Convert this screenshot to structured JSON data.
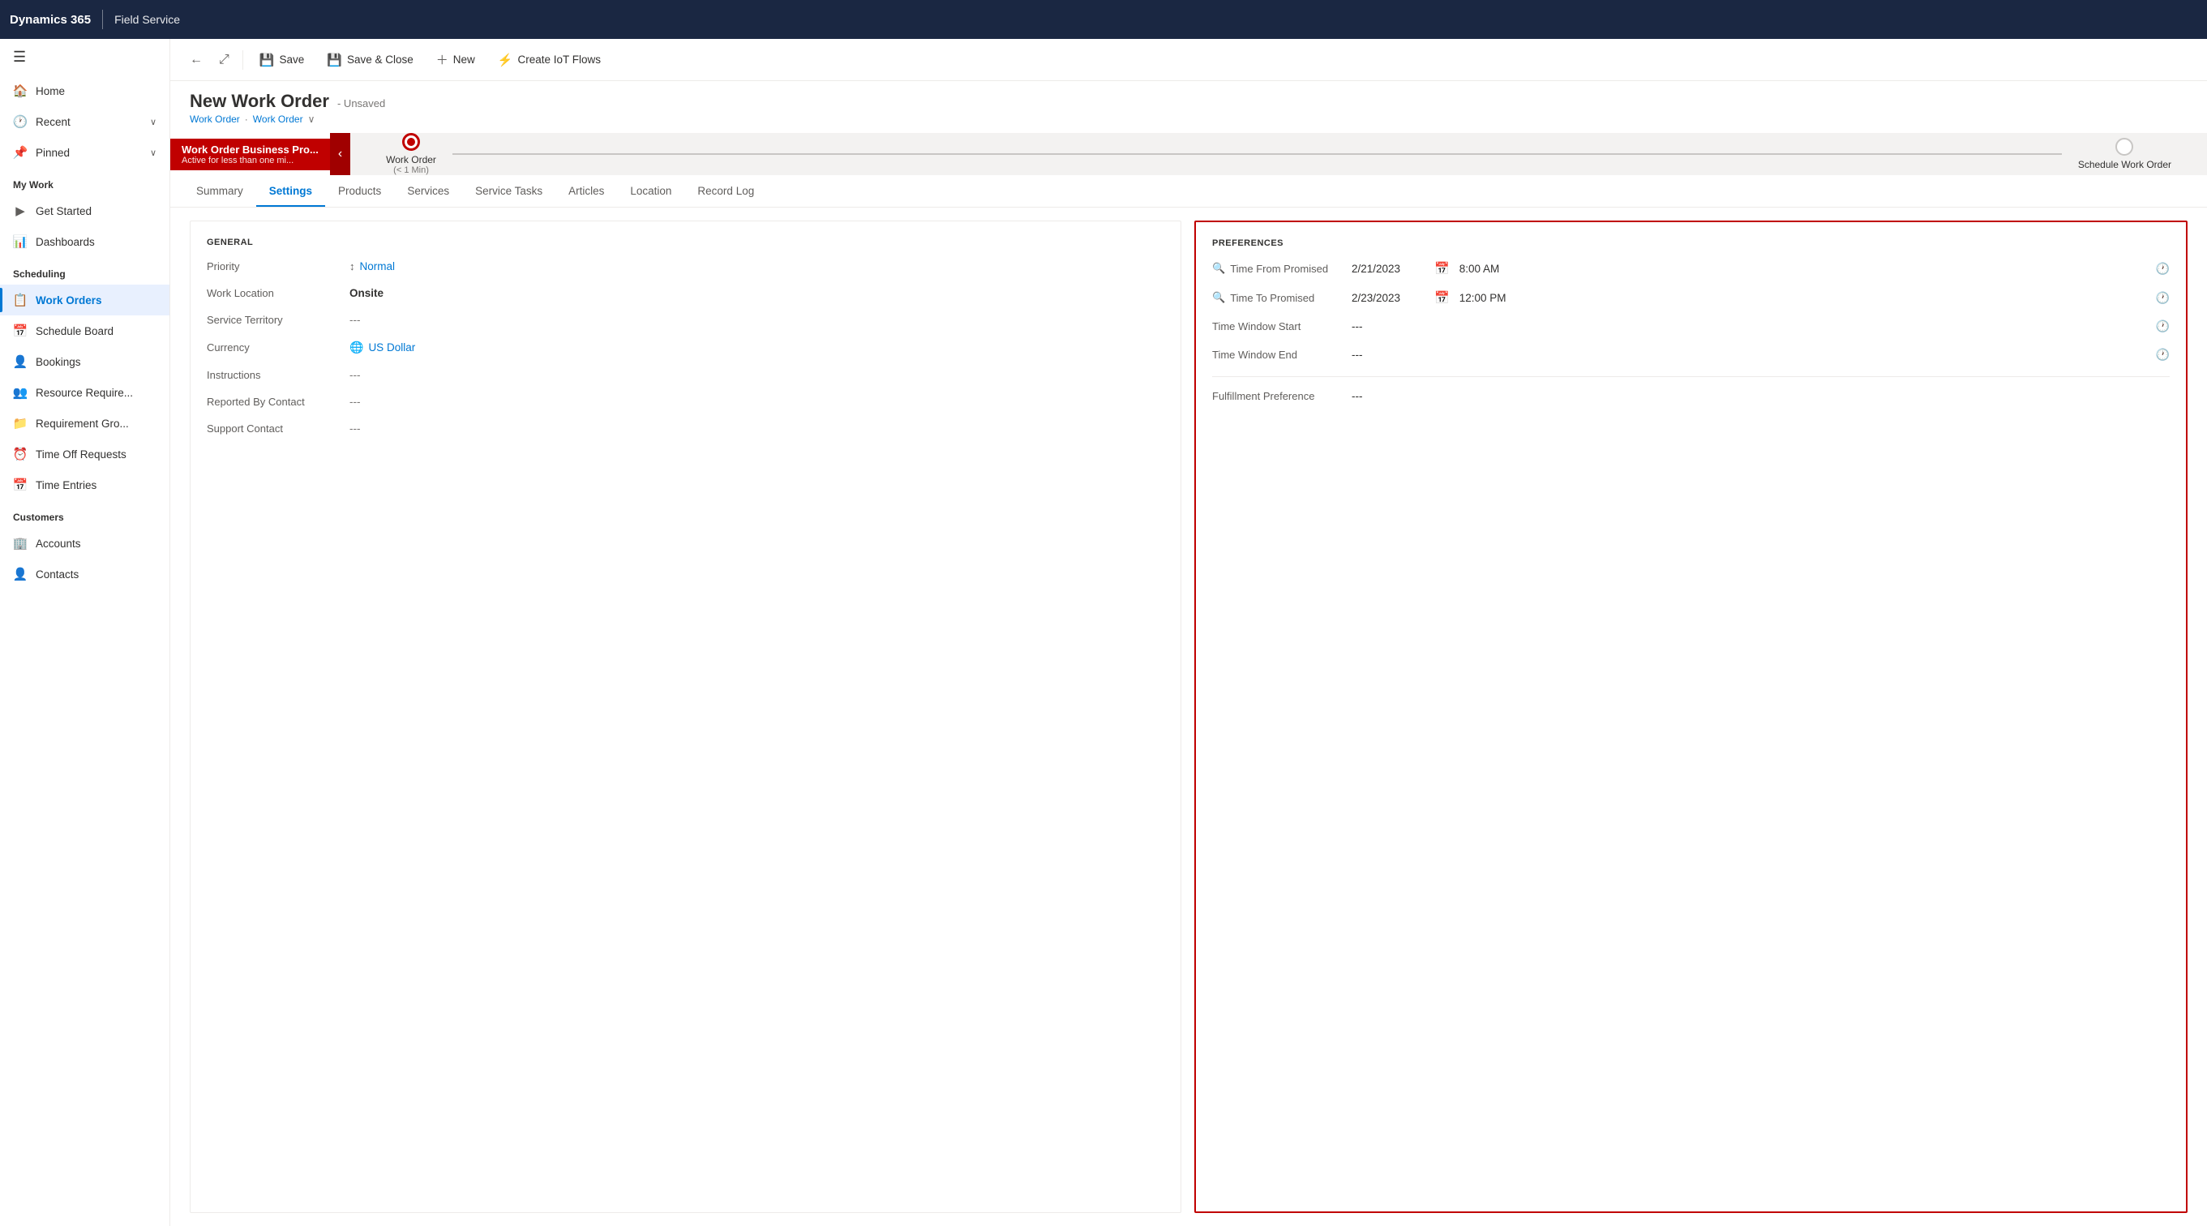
{
  "topbar": {
    "app_name": "Dynamics 365",
    "module_name": "Field Service"
  },
  "sidebar": {
    "hamburger_icon": "☰",
    "nav_items": [
      {
        "id": "home",
        "label": "Home",
        "icon": "🏠"
      },
      {
        "id": "recent",
        "label": "Recent",
        "icon": "🕐",
        "has_chevron": true
      },
      {
        "id": "pinned",
        "label": "Pinned",
        "icon": "📌",
        "has_chevron": true
      }
    ],
    "sections": [
      {
        "title": "My Work",
        "items": [
          {
            "id": "get-started",
            "label": "Get Started",
            "icon": "▶"
          },
          {
            "id": "dashboards",
            "label": "Dashboards",
            "icon": "📊"
          }
        ]
      },
      {
        "title": "Scheduling",
        "items": [
          {
            "id": "work-orders",
            "label": "Work Orders",
            "icon": "📋",
            "active": true
          },
          {
            "id": "schedule-board",
            "label": "Schedule Board",
            "icon": "📅"
          },
          {
            "id": "bookings",
            "label": "Bookings",
            "icon": "👤"
          },
          {
            "id": "resource-req",
            "label": "Resource Require...",
            "icon": "👥"
          },
          {
            "id": "requirement-gro",
            "label": "Requirement Gro...",
            "icon": "📁"
          },
          {
            "id": "time-off",
            "label": "Time Off Requests",
            "icon": "⏰"
          },
          {
            "id": "time-entries",
            "label": "Time Entries",
            "icon": "📅"
          }
        ]
      },
      {
        "title": "Customers",
        "items": [
          {
            "id": "accounts",
            "label": "Accounts",
            "icon": "🏢"
          },
          {
            "id": "contacts",
            "label": "Contacts",
            "icon": "👤"
          }
        ]
      }
    ]
  },
  "command_bar": {
    "back_btn": "←",
    "share_btn": "⤢",
    "save_label": "Save",
    "save_close_label": "Save & Close",
    "new_label": "New",
    "create_iot_label": "Create IoT Flows"
  },
  "record": {
    "title": "New Work Order",
    "status": "- Unsaved",
    "breadcrumb_parent": "Work Order",
    "breadcrumb_current": "Work Order",
    "breadcrumb_chevron": "∨"
  },
  "stages": [
    {
      "id": "work-order",
      "label": "Work Order",
      "sublabel": "< 1 Min",
      "active": true,
      "card_name": "Work Order Business Pro...",
      "card_sub": "Active for less than one mi..."
    },
    {
      "id": "schedule-work-order",
      "label": "Schedule Work Order",
      "sublabel": "",
      "active": false
    }
  ],
  "tabs": [
    {
      "id": "summary",
      "label": "Summary",
      "active": false
    },
    {
      "id": "settings",
      "label": "Settings",
      "active": true
    },
    {
      "id": "products",
      "label": "Products",
      "active": false
    },
    {
      "id": "services",
      "label": "Services",
      "active": false
    },
    {
      "id": "service-tasks",
      "label": "Service Tasks",
      "active": false
    },
    {
      "id": "articles",
      "label": "Articles",
      "active": false
    },
    {
      "id": "location",
      "label": "Location",
      "active": false
    },
    {
      "id": "record-log",
      "label": "Record Log",
      "active": false
    }
  ],
  "general_section": {
    "title": "GENERAL",
    "fields": [
      {
        "id": "priority",
        "label": "Priority",
        "value": "Normal",
        "type": "link",
        "has_icon": true
      },
      {
        "id": "work-location",
        "label": "Work Location",
        "value": "Onsite",
        "type": "bold"
      },
      {
        "id": "service-territory",
        "label": "Service Territory",
        "value": "---",
        "type": "empty"
      },
      {
        "id": "currency",
        "label": "Currency",
        "value": "US Dollar",
        "type": "link",
        "has_globe": true
      },
      {
        "id": "instructions",
        "label": "Instructions",
        "value": "---",
        "type": "empty"
      },
      {
        "id": "reported-by",
        "label": "Reported By Contact",
        "value": "---",
        "type": "empty"
      },
      {
        "id": "support-contact",
        "label": "Support Contact",
        "value": "---",
        "type": "empty"
      }
    ]
  },
  "preferences_section": {
    "title": "PREFERENCES",
    "fields": [
      {
        "id": "time-from",
        "label": "Time From Promised",
        "date": "2/21/2023",
        "time": "8:00 AM",
        "has_clock": true
      },
      {
        "id": "time-to",
        "label": "Time To Promised",
        "date": "2/23/2023",
        "time": "12:00 PM",
        "has_clock": true
      },
      {
        "id": "window-start",
        "label": "Time Window Start",
        "date": "---",
        "time": "",
        "has_clock": true
      },
      {
        "id": "window-end",
        "label": "Time Window End",
        "date": "---",
        "time": "",
        "has_clock": true
      }
    ],
    "fulfillment": {
      "label": "Fulfillment Preference",
      "value": "---"
    }
  }
}
